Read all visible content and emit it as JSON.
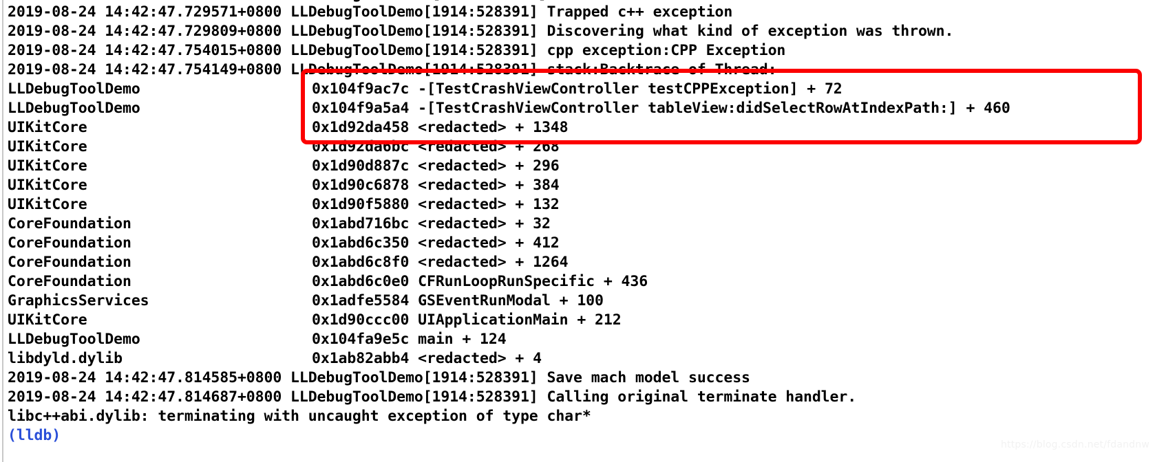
{
  "console": {
    "background_color": "#ffffff",
    "text_color": "#000000",
    "prompt_color": "#2b50d8",
    "annotation_color": "#fc0000",
    "watermark": "https://blog.csdn.net/fdandnw",
    "top_clipped_line": "2019-08-24 14:42:47.729??? +0800 LLDebugToolDemo[1914:528391]",
    "lines": [
      {
        "kind": "log",
        "text": "2019-08-24 14:42:47.729571+0800 LLDebugToolDemo[1914:528391] Trapped c++ exception"
      },
      {
        "kind": "log",
        "text": "2019-08-24 14:42:47.729809+0800 LLDebugToolDemo[1914:528391] Discovering what kind of exception was thrown."
      },
      {
        "kind": "log",
        "text": "2019-08-24 14:42:47.754015+0800 LLDebugToolDemo[1914:528391] cpp exception:CPP Exception"
      },
      {
        "kind": "log",
        "text": "2019-08-24 14:42:47.754149+0800 LLDebugToolDemo[1914:528391] stack:Backtrace of Thread:"
      },
      {
        "kind": "frame",
        "module": "LLDebugToolDemo",
        "address": "0x104f9ac7c",
        "symbol": "-[TestCrashViewController testCPPException] + 72"
      },
      {
        "kind": "frame",
        "module": "LLDebugToolDemo",
        "address": "0x104f9a5a4",
        "symbol": "-[TestCrashViewController tableView:didSelectRowAtIndexPath:] + 460"
      },
      {
        "kind": "frame",
        "module": "UIKitCore",
        "address": "0x1d92da458",
        "symbol": "<redacted> + 1348"
      },
      {
        "kind": "frame",
        "module": "UIKitCore",
        "address": "0x1d92da6bc",
        "symbol": "<redacted> + 268"
      },
      {
        "kind": "frame",
        "module": "UIKitCore",
        "address": "0x1d90d887c",
        "symbol": "<redacted> + 296"
      },
      {
        "kind": "frame",
        "module": "UIKitCore",
        "address": "0x1d90c6878",
        "symbol": "<redacted> + 384"
      },
      {
        "kind": "frame",
        "module": "UIKitCore",
        "address": "0x1d90f5880",
        "symbol": "<redacted> + 132"
      },
      {
        "kind": "frame",
        "module": "CoreFoundation",
        "address": "0x1abd716bc",
        "symbol": "<redacted> + 32"
      },
      {
        "kind": "frame",
        "module": "CoreFoundation",
        "address": "0x1abd6c350",
        "symbol": "<redacted> + 412"
      },
      {
        "kind": "frame",
        "module": "CoreFoundation",
        "address": "0x1abd6c8f0",
        "symbol": "<redacted> + 1264"
      },
      {
        "kind": "frame",
        "module": "CoreFoundation",
        "address": "0x1abd6c0e0",
        "symbol": "CFRunLoopRunSpecific + 436"
      },
      {
        "kind": "frame",
        "module": "GraphicsServices",
        "address": "0x1adfe5584",
        "symbol": "GSEventRunModal + 100"
      },
      {
        "kind": "frame",
        "module": "UIKitCore",
        "address": "0x1d90ccc00",
        "symbol": "UIApplicationMain + 212"
      },
      {
        "kind": "frame",
        "module": "LLDebugToolDemo",
        "address": "0x104fa9e5c",
        "symbol": "main + 124"
      },
      {
        "kind": "frame",
        "module": "libdyld.dylib",
        "address": "0x1ab82abb4",
        "symbol": "<redacted> + 4"
      },
      {
        "kind": "log",
        "text": "2019-08-24 14:42:47.814585+0800 LLDebugToolDemo[1914:528391] Save mach model success"
      },
      {
        "kind": "log",
        "text": "2019-08-24 14:42:47.814687+0800 LLDebugToolDemo[1914:528391] Calling original terminate handler."
      },
      {
        "kind": "log",
        "text": "libc++abi.dylib: terminating with uncaught exception of type char*"
      },
      {
        "kind": "prompt",
        "text": "(lldb)"
      }
    ],
    "annotation": {
      "shape": "rectangle",
      "color": "#fc0000",
      "highlights": [
        "0x104f9ac7c -[TestCrashViewController testCPPException] + 72",
        "0x104f9a5a4 -[TestCrashViewController tableView:didSelectRowAtIndexPath:] + 460",
        "0x1d92da458 <redacted> + 1348"
      ]
    }
  }
}
